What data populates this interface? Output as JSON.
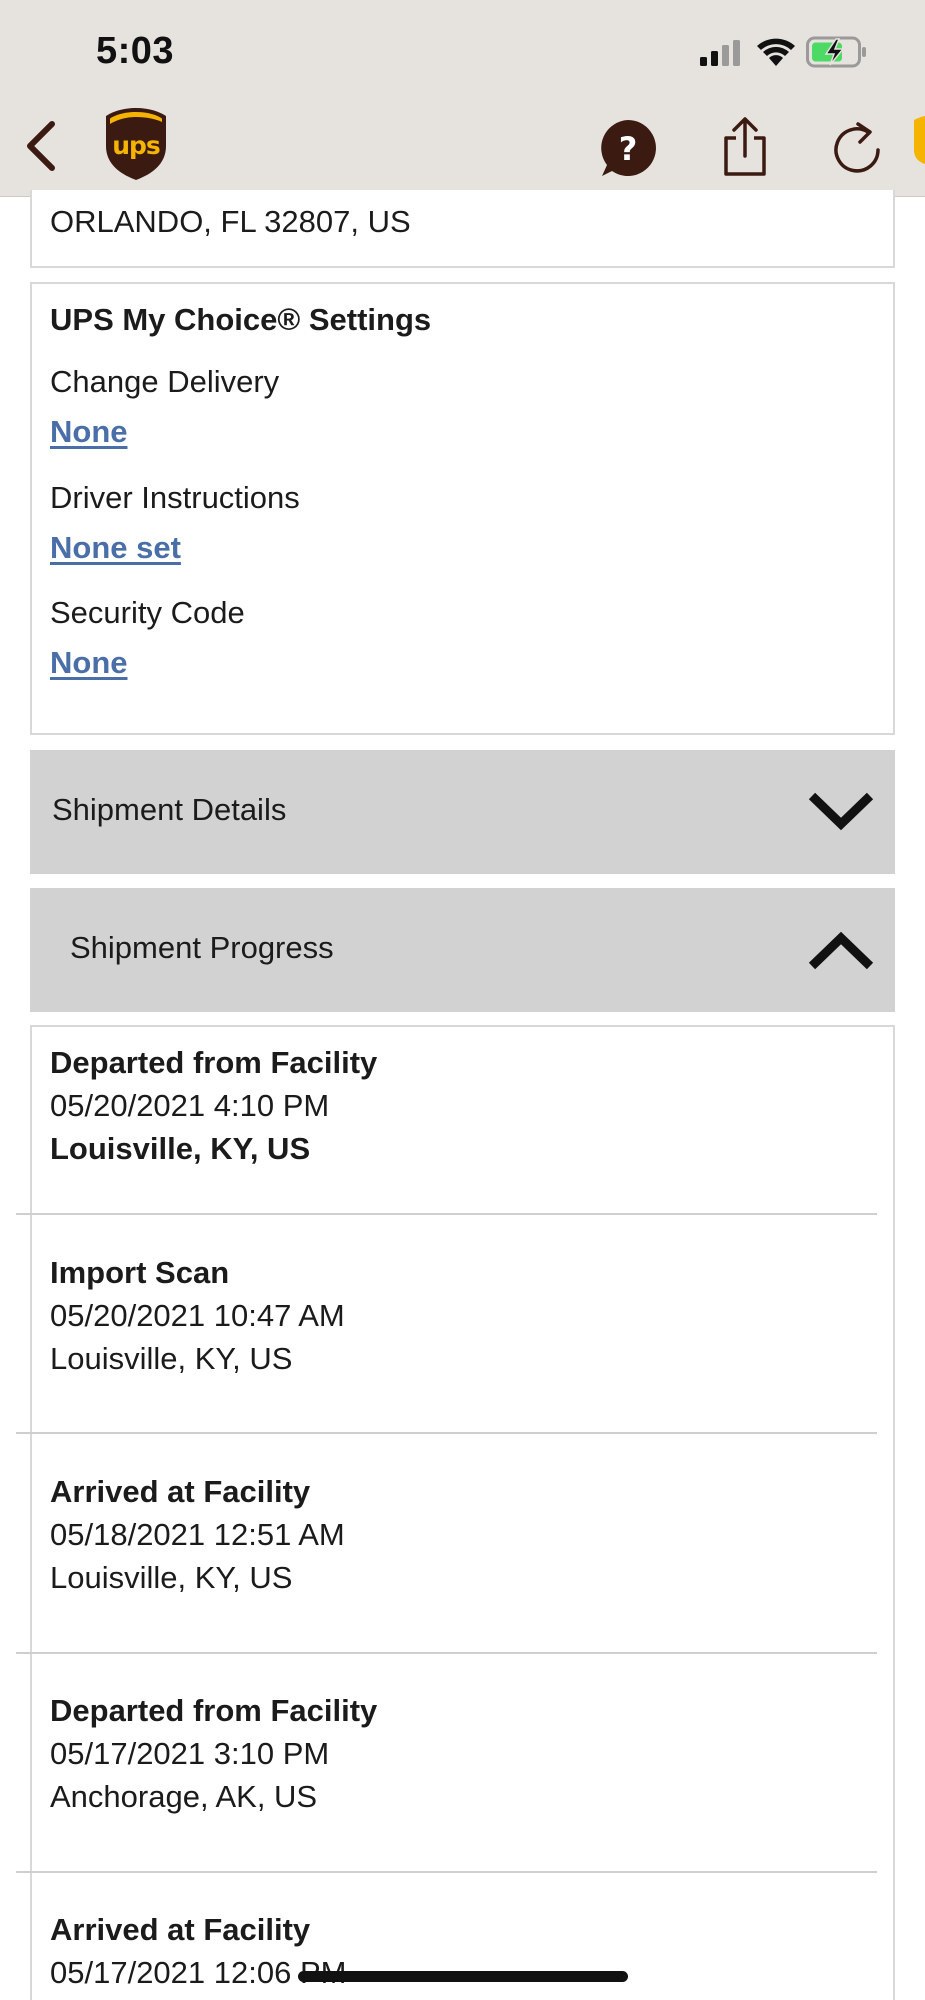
{
  "status_bar": {
    "time": "5:03"
  },
  "nav": {
    "logo_text": "ups"
  },
  "address": {
    "line": "ORLANDO, FL 32807, US"
  },
  "my_choice": {
    "title": "UPS My Choice® Settings",
    "fields": [
      {
        "label": "Change Delivery",
        "value": "None"
      },
      {
        "label": "Driver Instructions",
        "value": "None set"
      },
      {
        "label": "Security Code",
        "value": "None"
      }
    ]
  },
  "sections": {
    "details": {
      "label": "Shipment Details",
      "state": "collapsed"
    },
    "progress": {
      "label": "Shipment Progress",
      "state": "expanded"
    }
  },
  "events": [
    {
      "status": "Departed from Facility",
      "datetime": "05/20/2021 4:10 PM",
      "location": "Louisville, KY, US"
    },
    {
      "status": "Import Scan",
      "datetime": "05/20/2021 10:47 AM",
      "location": "Louisville, KY, US"
    },
    {
      "status": "Arrived at Facility",
      "datetime": "05/18/2021 12:51 AM",
      "location": "Louisville, KY, US"
    },
    {
      "status": "Departed from Facility",
      "datetime": "05/17/2021 3:10 PM",
      "location": "Anchorage, AK, US"
    },
    {
      "status": "Arrived at Facility",
      "datetime": "05/17/2021 12:06 PM",
      "location": ""
    }
  ],
  "colors": {
    "ups_brown": "#3b1a12",
    "ups_gold": "#f4b400",
    "link_blue": "#4a6ea8",
    "header_bg": "#e6e3df",
    "accordion_bg": "#d2d2d2"
  },
  "icons": [
    "back-chevron-icon",
    "ups-logo-icon",
    "help-icon",
    "share-icon",
    "refresh-icon",
    "chevron-down-icon",
    "chevron-up-icon"
  ]
}
